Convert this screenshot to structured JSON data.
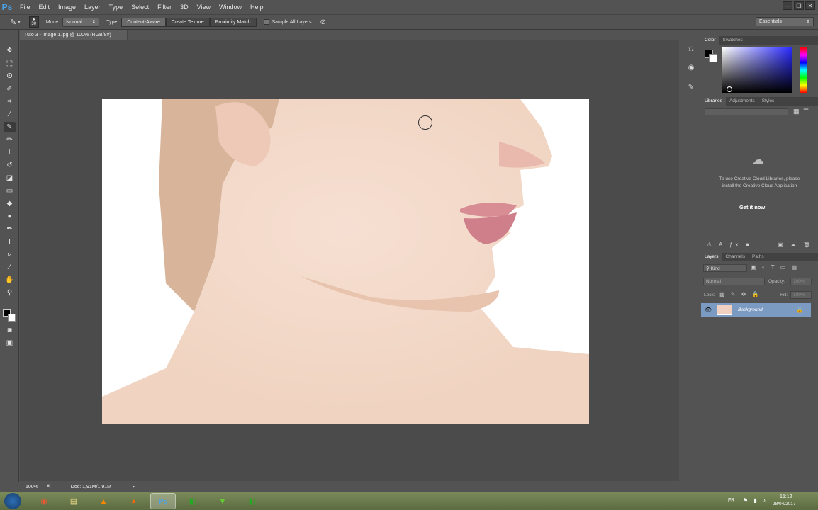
{
  "app": {
    "logo": "Ps",
    "menu": [
      "File",
      "Edit",
      "Image",
      "Layer",
      "Type",
      "Select",
      "Filter",
      "3D",
      "View",
      "Window",
      "Help"
    ],
    "window_controls": [
      "—",
      "❐",
      "✕"
    ]
  },
  "options": {
    "brush_size": "30",
    "mode_label": "Mode:",
    "mode_value": "Normal",
    "type_label": "Type:",
    "type_buttons": [
      "Content-Aware",
      "Create Texture",
      "Proximity Match"
    ],
    "sample_all_layers": "Sample All Layers",
    "workspace": "Essentials"
  },
  "document": {
    "tab_title": "Tuto 3 - Image 1.jpg @ 100% (RGB/8#)",
    "zoom": "100%",
    "doc_info": "Doc: 1,91M/1,91M"
  },
  "panels": {
    "color_tabs": [
      "Color",
      "Swatches"
    ],
    "library_tabs": [
      "Libraries",
      "Adjustments",
      "Styles"
    ],
    "library_message": "To use Creative Cloud Libraries, please install the Creative Cloud Application",
    "library_link": "Get it now!",
    "layers_tabs": [
      "Layers",
      "Channels",
      "Paths"
    ],
    "layers_filter": "Kind",
    "blend_mode": "Normal",
    "opacity_label": "Opacity:",
    "opacity_value": "100%",
    "lock_label": "Lock:",
    "fill_label": "Fill:",
    "fill_value": "100%",
    "layer_name": "Background"
  },
  "taskbar": {
    "lang": "FR",
    "time": "15:12",
    "date": "28/04/2017"
  },
  "colors": {
    "accent": "#4aa3e6",
    "panel_bg": "#535353",
    "canvas_bg": "#4b4b4b",
    "selected_layer": "#7c9bc2"
  }
}
